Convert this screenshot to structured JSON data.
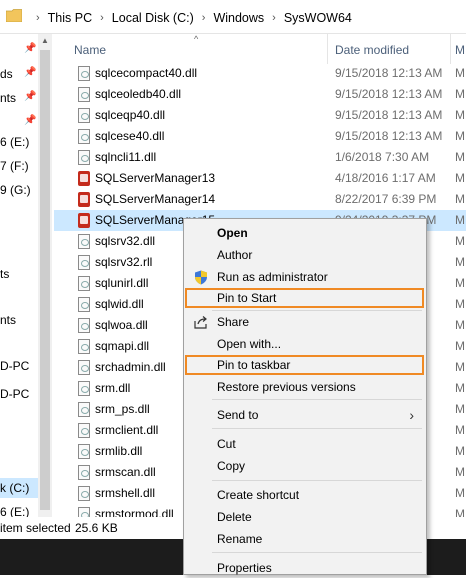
{
  "address": {
    "crumbs": [
      "This PC",
      "Local Disk (C:)",
      "Windows",
      "SysWOW64"
    ]
  },
  "nav": {
    "items": [
      "ds",
      "nts",
      "6 (E:)",
      "7 (F:)",
      "9 (G:)",
      "ts",
      "nts",
      "D-PC",
      "D-PC",
      "k (C:)",
      "6 (E:)"
    ]
  },
  "columns": {
    "name": "Name",
    "date": "Date modified",
    "type": "M"
  },
  "files": [
    {
      "name": "sqlcecompact40.dll",
      "date": "9/15/2018 12:13 AM",
      "type": "M",
      "icon": "dll-icon"
    },
    {
      "name": "sqlceoledb40.dll",
      "date": "9/15/2018 12:13 AM",
      "type": "M",
      "icon": "dll-icon"
    },
    {
      "name": "sqlceqp40.dll",
      "date": "9/15/2018 12:13 AM",
      "type": "M",
      "icon": "dll-icon"
    },
    {
      "name": "sqlcese40.dll",
      "date": "9/15/2018 12:13 AM",
      "type": "M",
      "icon": "dll-icon"
    },
    {
      "name": "sqlncli11.dll",
      "date": "1/6/2018 7:30 AM",
      "type": "M",
      "icon": "dll-icon"
    },
    {
      "name": "SQLServerManager13",
      "date": "4/18/2016 1:17 AM",
      "type": "M",
      "icon": "sqlserver-manager-icon"
    },
    {
      "name": "SQLServerManager14",
      "date": "8/22/2017 6:39 PM",
      "type": "M",
      "icon": "sqlserver-manager-icon"
    },
    {
      "name": "SQLServerManager15",
      "date": "9/24/2019 3:37 PM",
      "type": "M",
      "icon": "sqlserver-manager-icon"
    },
    {
      "name": "sqlsrv32.dll",
      "date": "",
      "type": "M",
      "icon": "dll-icon"
    },
    {
      "name": "sqlsrv32.rll",
      "date": "",
      "type": "M",
      "icon": "dll-icon"
    },
    {
      "name": "sqlunirl.dll",
      "date": "",
      "type": "M",
      "icon": "dll-icon"
    },
    {
      "name": "sqlwid.dll",
      "date": "",
      "type": "M",
      "icon": "dll-icon"
    },
    {
      "name": "sqlwoa.dll",
      "date": "",
      "type": "M",
      "icon": "dll-icon"
    },
    {
      "name": "sqmapi.dll",
      "date": "",
      "type": "M",
      "icon": "dll-icon"
    },
    {
      "name": "srchadmin.dll",
      "date": "",
      "type": "M",
      "icon": "dll-icon"
    },
    {
      "name": "srm.dll",
      "date": "",
      "type": "M",
      "icon": "dll-icon"
    },
    {
      "name": "srm_ps.dll",
      "date": "",
      "type": "M",
      "icon": "dll-icon"
    },
    {
      "name": "srmclient.dll",
      "date": "",
      "type": "M",
      "icon": "dll-icon"
    },
    {
      "name": "srmlib.dll",
      "date": "",
      "type": "M",
      "icon": "dll-icon"
    },
    {
      "name": "srmscan.dll",
      "date": "",
      "type": "M",
      "icon": "dll-icon"
    },
    {
      "name": "srmshell.dll",
      "date": "",
      "type": "M",
      "icon": "dll-icon"
    },
    {
      "name": "srmstormod.dll",
      "date": "",
      "type": "M",
      "icon": "dll-icon"
    }
  ],
  "status": {
    "count": "item selected",
    "size": "25.6 KB"
  },
  "context_menu": {
    "open": "Open",
    "author": "Author",
    "run_as_admin": "Run as administrator",
    "pin_to_start": "Pin to Start",
    "share": "Share",
    "open_with": "Open with...",
    "pin_to_taskbar": "Pin to taskbar",
    "restore_previous": "Restore previous versions",
    "send_to": "Send to",
    "cut": "Cut",
    "copy": "Copy",
    "create_shortcut": "Create shortcut",
    "delete": "Delete",
    "rename": "Rename",
    "properties": "Properties"
  },
  "colors": {
    "selection": "#cce8ff",
    "highlight_outline": "#f08a24",
    "taskbar": "#1c1c1c"
  }
}
